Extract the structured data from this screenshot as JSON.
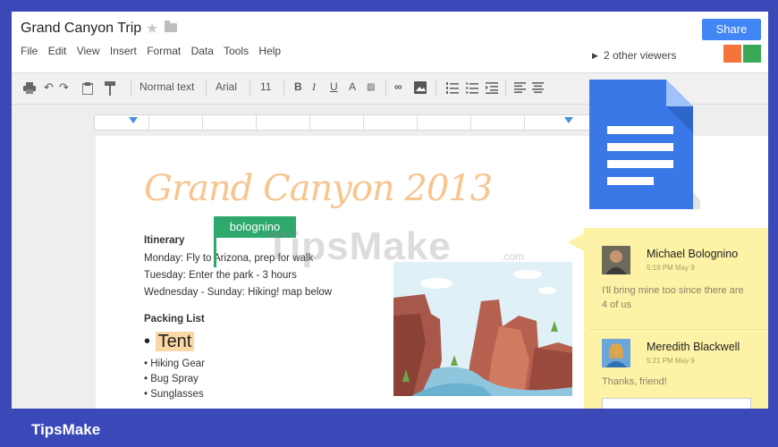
{
  "app": {
    "doc_title": "Grand Canyon Trip",
    "star_icon": "star-icon",
    "folder_icon": "folder-icon",
    "share_label": "Share",
    "viewers_text": "2 other viewers",
    "viewer_colors": [
      "#f4743b",
      "#3aa757"
    ],
    "accent": "#4285f4"
  },
  "menu": [
    "File",
    "Edit",
    "View",
    "Insert",
    "Format",
    "Data",
    "Tools",
    "Help"
  ],
  "toolbar": {
    "style_label": "Normal text",
    "font_label": "Arial",
    "size_label": "11",
    "bold_label": "B",
    "italic_label": "I",
    "underline_label": "U",
    "text_color_label": "A"
  },
  "document": {
    "heading": "Grand Canyon 2013",
    "itinerary_title": "Itinerary",
    "lines": [
      "Monday: Fly to Arizona, prep for walk",
      "Tuesday: Enter the park - 3 hours",
      "Wednesday - Sunday: Hiking!  map below"
    ],
    "packing_title": "Packing List",
    "tent_label": "Tent",
    "packing_items": [
      "Hiking Gear",
      "Bug Spray",
      "Sunglasses"
    ],
    "cursor_user": "bolognino"
  },
  "comments": [
    {
      "name": "Michael Bolognino",
      "time": "5:19 PM May 9",
      "text": "I'll bring mine too since there are 4 of us"
    },
    {
      "name": "Meredith Blackwell",
      "time": "5:21 PM May 9",
      "text": "Thanks, friend!"
    }
  ],
  "watermark": {
    "text": "TipsMake",
    "sub": ".com"
  },
  "footer": {
    "brand": "TipsMake"
  }
}
